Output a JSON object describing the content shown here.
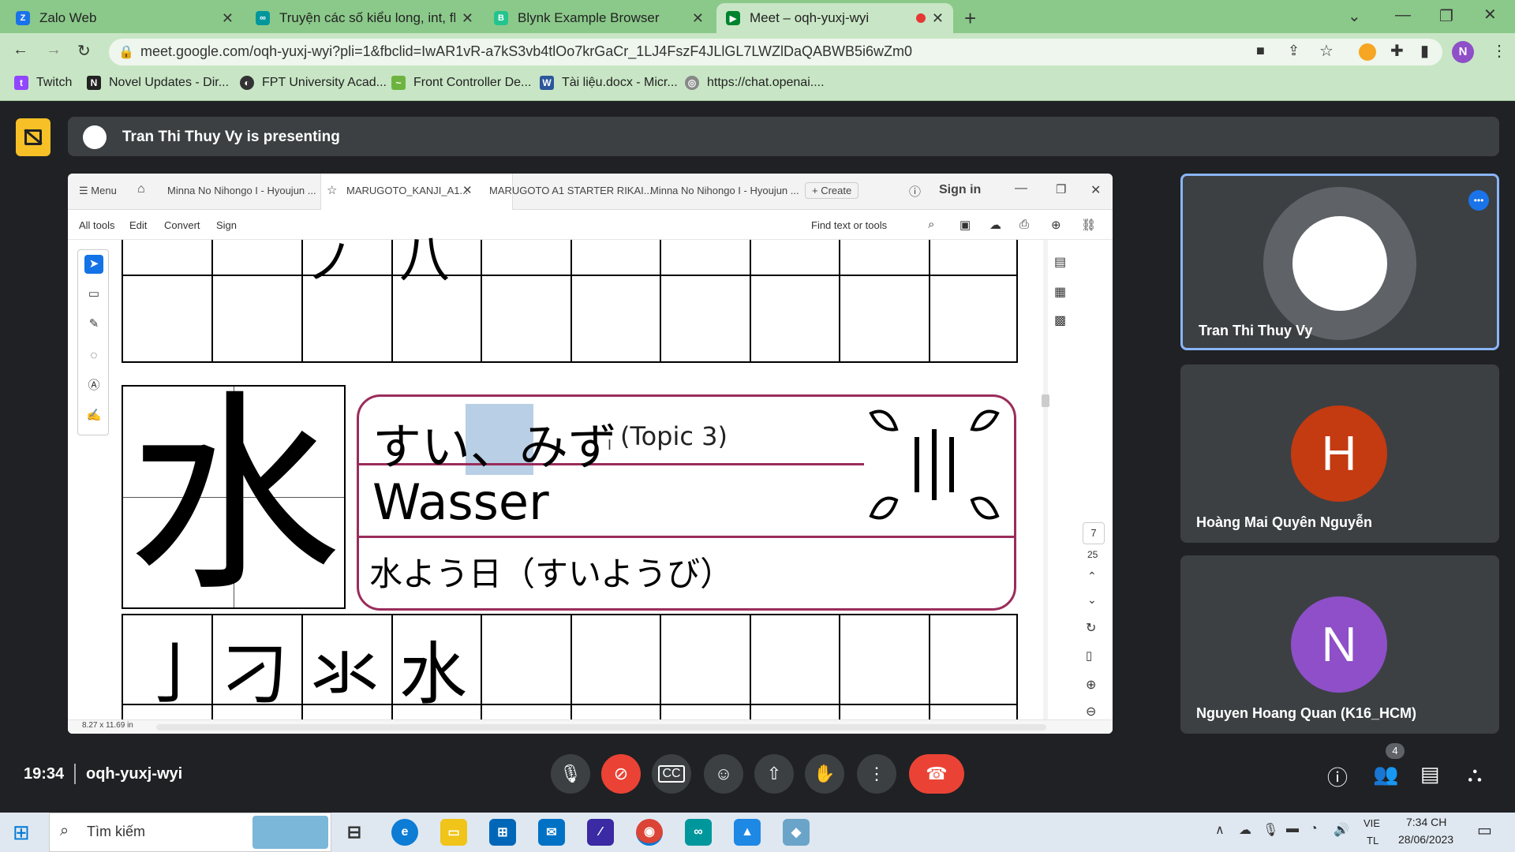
{
  "browser": {
    "tabs": [
      {
        "title": "Zalo Web",
        "favicon": "zalo-icon",
        "color": "#1a73e8"
      },
      {
        "title": "Truyện các số kiểu long, int, float",
        "favicon": "arduino-icon",
        "color": "#00979c"
      },
      {
        "title": "Blynk Example Browser",
        "favicon": "blynk-icon",
        "color": "#23c48e"
      },
      {
        "title": "Meet – oqh-yuxj-wyi",
        "favicon": "meet-icon",
        "color": "#00832d"
      }
    ],
    "url": "meet.google.com/oqh-yuxj-wyi?pli=1&fbclid=IwAR1vR-a7kS3vb4tlOo7krGaCr_1LJ4FszF4JLlGL7LWZlDaQABWB5i6wZm0",
    "profile_initial": "N",
    "bookmarks": [
      "Twitch",
      "Novel Updates - Dir...",
      "FPT University Acad...",
      "Front Controller De...",
      "Tài liệu.docx - Micr...",
      "https://chat.openai...."
    ]
  },
  "meet": {
    "presenting_text": "Tran Thi Thuy Vy is presenting",
    "time": "19:34",
    "meeting_id": "oqh-yuxj-wyi",
    "participant_count": "4",
    "participants": [
      {
        "name": "Tran Thi Thuy Vy",
        "initial": "",
        "color": "#ffffff"
      },
      {
        "name": "Hoàng Mai Quyên Nguyễn",
        "initial": "H",
        "color": "#c43a11"
      },
      {
        "name": "Nguyen Hoang Quan (K16_HCM)",
        "initial": "N",
        "color": "#8e4fc8"
      }
    ]
  },
  "pdf": {
    "tabs": [
      "Menu",
      "Minna No Nihongo I - Hyoujun ...",
      "MARUGOTO_KANJI_A1...",
      "MARUGOTO A1 STARTER RIKAI...",
      "Minna No Nihongo I - Hyoujun ...",
      "Create",
      "Sign in"
    ],
    "toolbar": [
      "All tools",
      "Edit",
      "Convert",
      "Sign"
    ],
    "find_text": "Find text or tools",
    "page_current": "7",
    "page_total": "25",
    "page_size": "8.27 x 11.69 in",
    "kanji": "水",
    "reading": "すい、みず",
    "topic": "(Topic 3)",
    "meaning": "Wasser",
    "example": "水よう日（すいようび）",
    "stroke_steps": [
      "亅",
      "刁",
      "氺",
      "水"
    ]
  },
  "taskbar": {
    "search_text": "Tìm kiếm",
    "lang": "VIE",
    "layout": "TL",
    "time": "7:34 CH",
    "date": "28/06/2023"
  }
}
